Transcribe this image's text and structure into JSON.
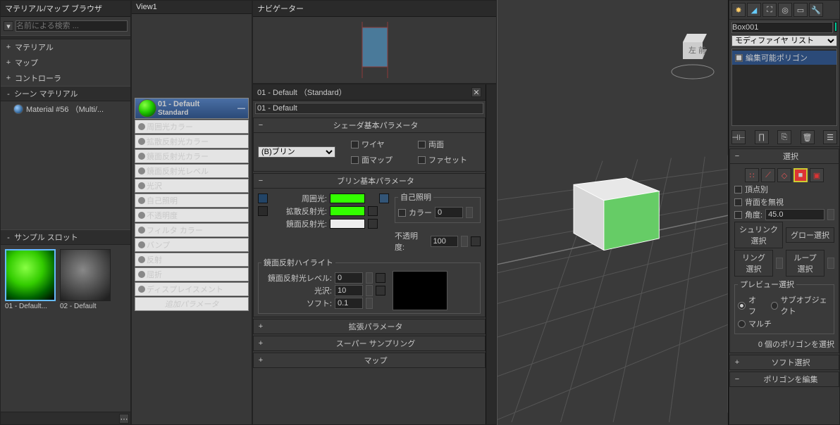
{
  "browser": {
    "title": "マテリアル/マップ ブラウザ",
    "search_placeholder": "名前による検索 ...",
    "tree": {
      "materials": "マテリアル",
      "maps": "マップ",
      "controllers": "コントローラ",
      "sceneMaterials": "シーン マテリアル",
      "mat56": "Material #56 （Multi/..."
    },
    "sampleSlots": "サンプル スロット",
    "slotLabels": [
      "01 - Default...",
      "02 - Default"
    ]
  },
  "view1": {
    "title": "View1",
    "node": {
      "name": "01 - Default",
      "type": "Standard"
    },
    "props": [
      "周囲光カラー",
      "拡散反射光カラー",
      "鏡面反射光カラー",
      "鏡面反射光レベル",
      "光沢",
      "自己照明",
      "不透明度",
      "フィルタ カラー",
      "バンプ",
      "反射",
      "屈折",
      "ディスプレイスメント"
    ],
    "extra": "追加パラメータ"
  },
  "navigator": {
    "title": "ナビゲーター"
  },
  "matEditor": {
    "header": "01 - Default （Standard）",
    "nameField": "01 - Default",
    "shaderBasic": {
      "title": "シェーダ基本パラメータ",
      "shader": "(B)ブリン",
      "wire": "ワイヤ",
      "twoSided": "両面",
      "faceMap": "面マップ",
      "faceted": "ファセット"
    },
    "blinnBasic": {
      "title": "ブリン基本パラメータ",
      "ambient": "周囲光:",
      "diffuse": "拡散反射光:",
      "specular": "鏡面反射光:",
      "selfIllum": {
        "group": "自己照明",
        "colorLabel": "カラー",
        "value": "0"
      },
      "opacity": {
        "label": "不透明度:",
        "value": "100"
      }
    },
    "specHighlight": {
      "title": "鏡面反射ハイライト",
      "level": "鏡面反射光レベル:",
      "levelVal": "0",
      "gloss": "光沢:",
      "glossVal": "10",
      "soft": "ソフト:",
      "softVal": "0.1"
    },
    "rollouts": {
      "extended": "拡張パラメータ",
      "supersampling": "スーパー サンプリング",
      "maps": "マップ"
    }
  },
  "viewport": {
    "objName": "Box001"
  },
  "modpanel": {
    "modListLabel": "モディファイヤ リスト",
    "stack": [
      "編集可能ポリゴン"
    ],
    "selection": {
      "title": "選択",
      "byVertex": "頂点別",
      "ignoreBack": "背面を無視",
      "angleLabel": "角度:",
      "angleVal": "45.0",
      "shrink": "シュリンク選択",
      "grow": "グロー選択",
      "ring": "リング選択",
      "loop": "ループ選択",
      "previewTitle": "プレビュー選択",
      "off": "オフ",
      "subobj": "サブオブジェクト",
      "multi": "マルチ",
      "status": "0 個のポリゴンを選択"
    },
    "softsel": "ソフト選択",
    "editpoly": "ポリゴンを編集"
  }
}
